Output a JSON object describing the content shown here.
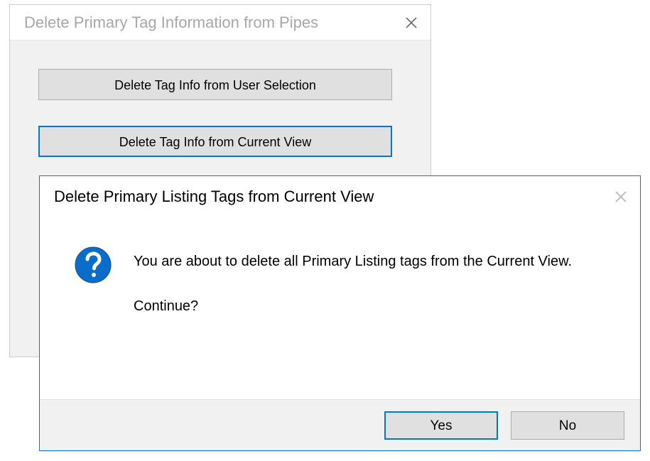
{
  "parent": {
    "title": "Delete Primary Tag Information from Pipes",
    "buttons": {
      "user_selection": "Delete Tag Info from User Selection",
      "current_view": "Delete Tag Info from Current View"
    }
  },
  "modal": {
    "title": "Delete Primary Listing Tags from Current View",
    "message_line1": "You are about to delete all Primary Listing tags from the Current View.",
    "message_line2": "Continue?",
    "buttons": {
      "yes": "Yes",
      "no": "No"
    }
  }
}
